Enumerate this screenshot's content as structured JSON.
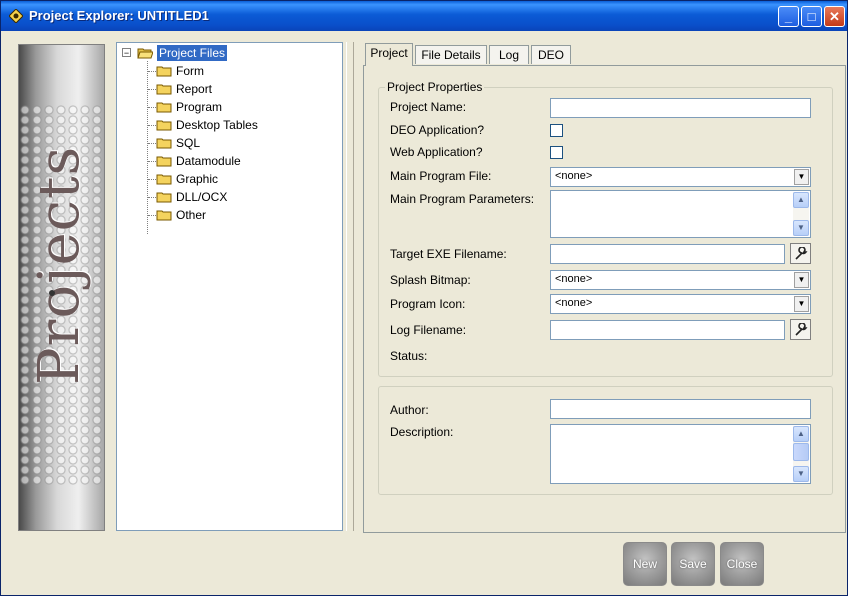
{
  "window": {
    "title": "Project Explorer: UNTITLED1",
    "controls": {
      "minimize": "_",
      "maximize": "□",
      "close": "✕"
    }
  },
  "sidebar_image": {
    "logo_text": "Projects"
  },
  "tree": {
    "root": {
      "label": "Project Files",
      "expander": "−"
    },
    "items": [
      "Form",
      "Report",
      "Program",
      "Desktop Tables",
      "SQL",
      "Datamodule",
      "Graphic",
      "DLL/OCX",
      "Other"
    ]
  },
  "tabs": [
    "Project",
    "File Details",
    "Log",
    "DEO"
  ],
  "project_properties": {
    "group_title": "Project Properties",
    "project_name_label": "Project Name:",
    "project_name_value": "",
    "deo_app_label": "DEO Application?",
    "web_app_label": "Web Application?",
    "main_program_label": "Main Program File:",
    "main_program_value": "<none>",
    "main_params_label": "Main Program Parameters:",
    "target_exe_label": "Target EXE Filename:",
    "target_exe_value": "",
    "splash_label": "Splash Bitmap:",
    "splash_value": "<none>",
    "icon_label": "Program Icon:",
    "icon_value": "<none>",
    "log_label": "Log Filename:",
    "log_value": "",
    "status_label": "Status:"
  },
  "author_section": {
    "author_label": "Author:",
    "author_value": "",
    "description_label": "Description:"
  },
  "buttons": {
    "new": "New",
    "save": "Save",
    "close": "Close"
  }
}
